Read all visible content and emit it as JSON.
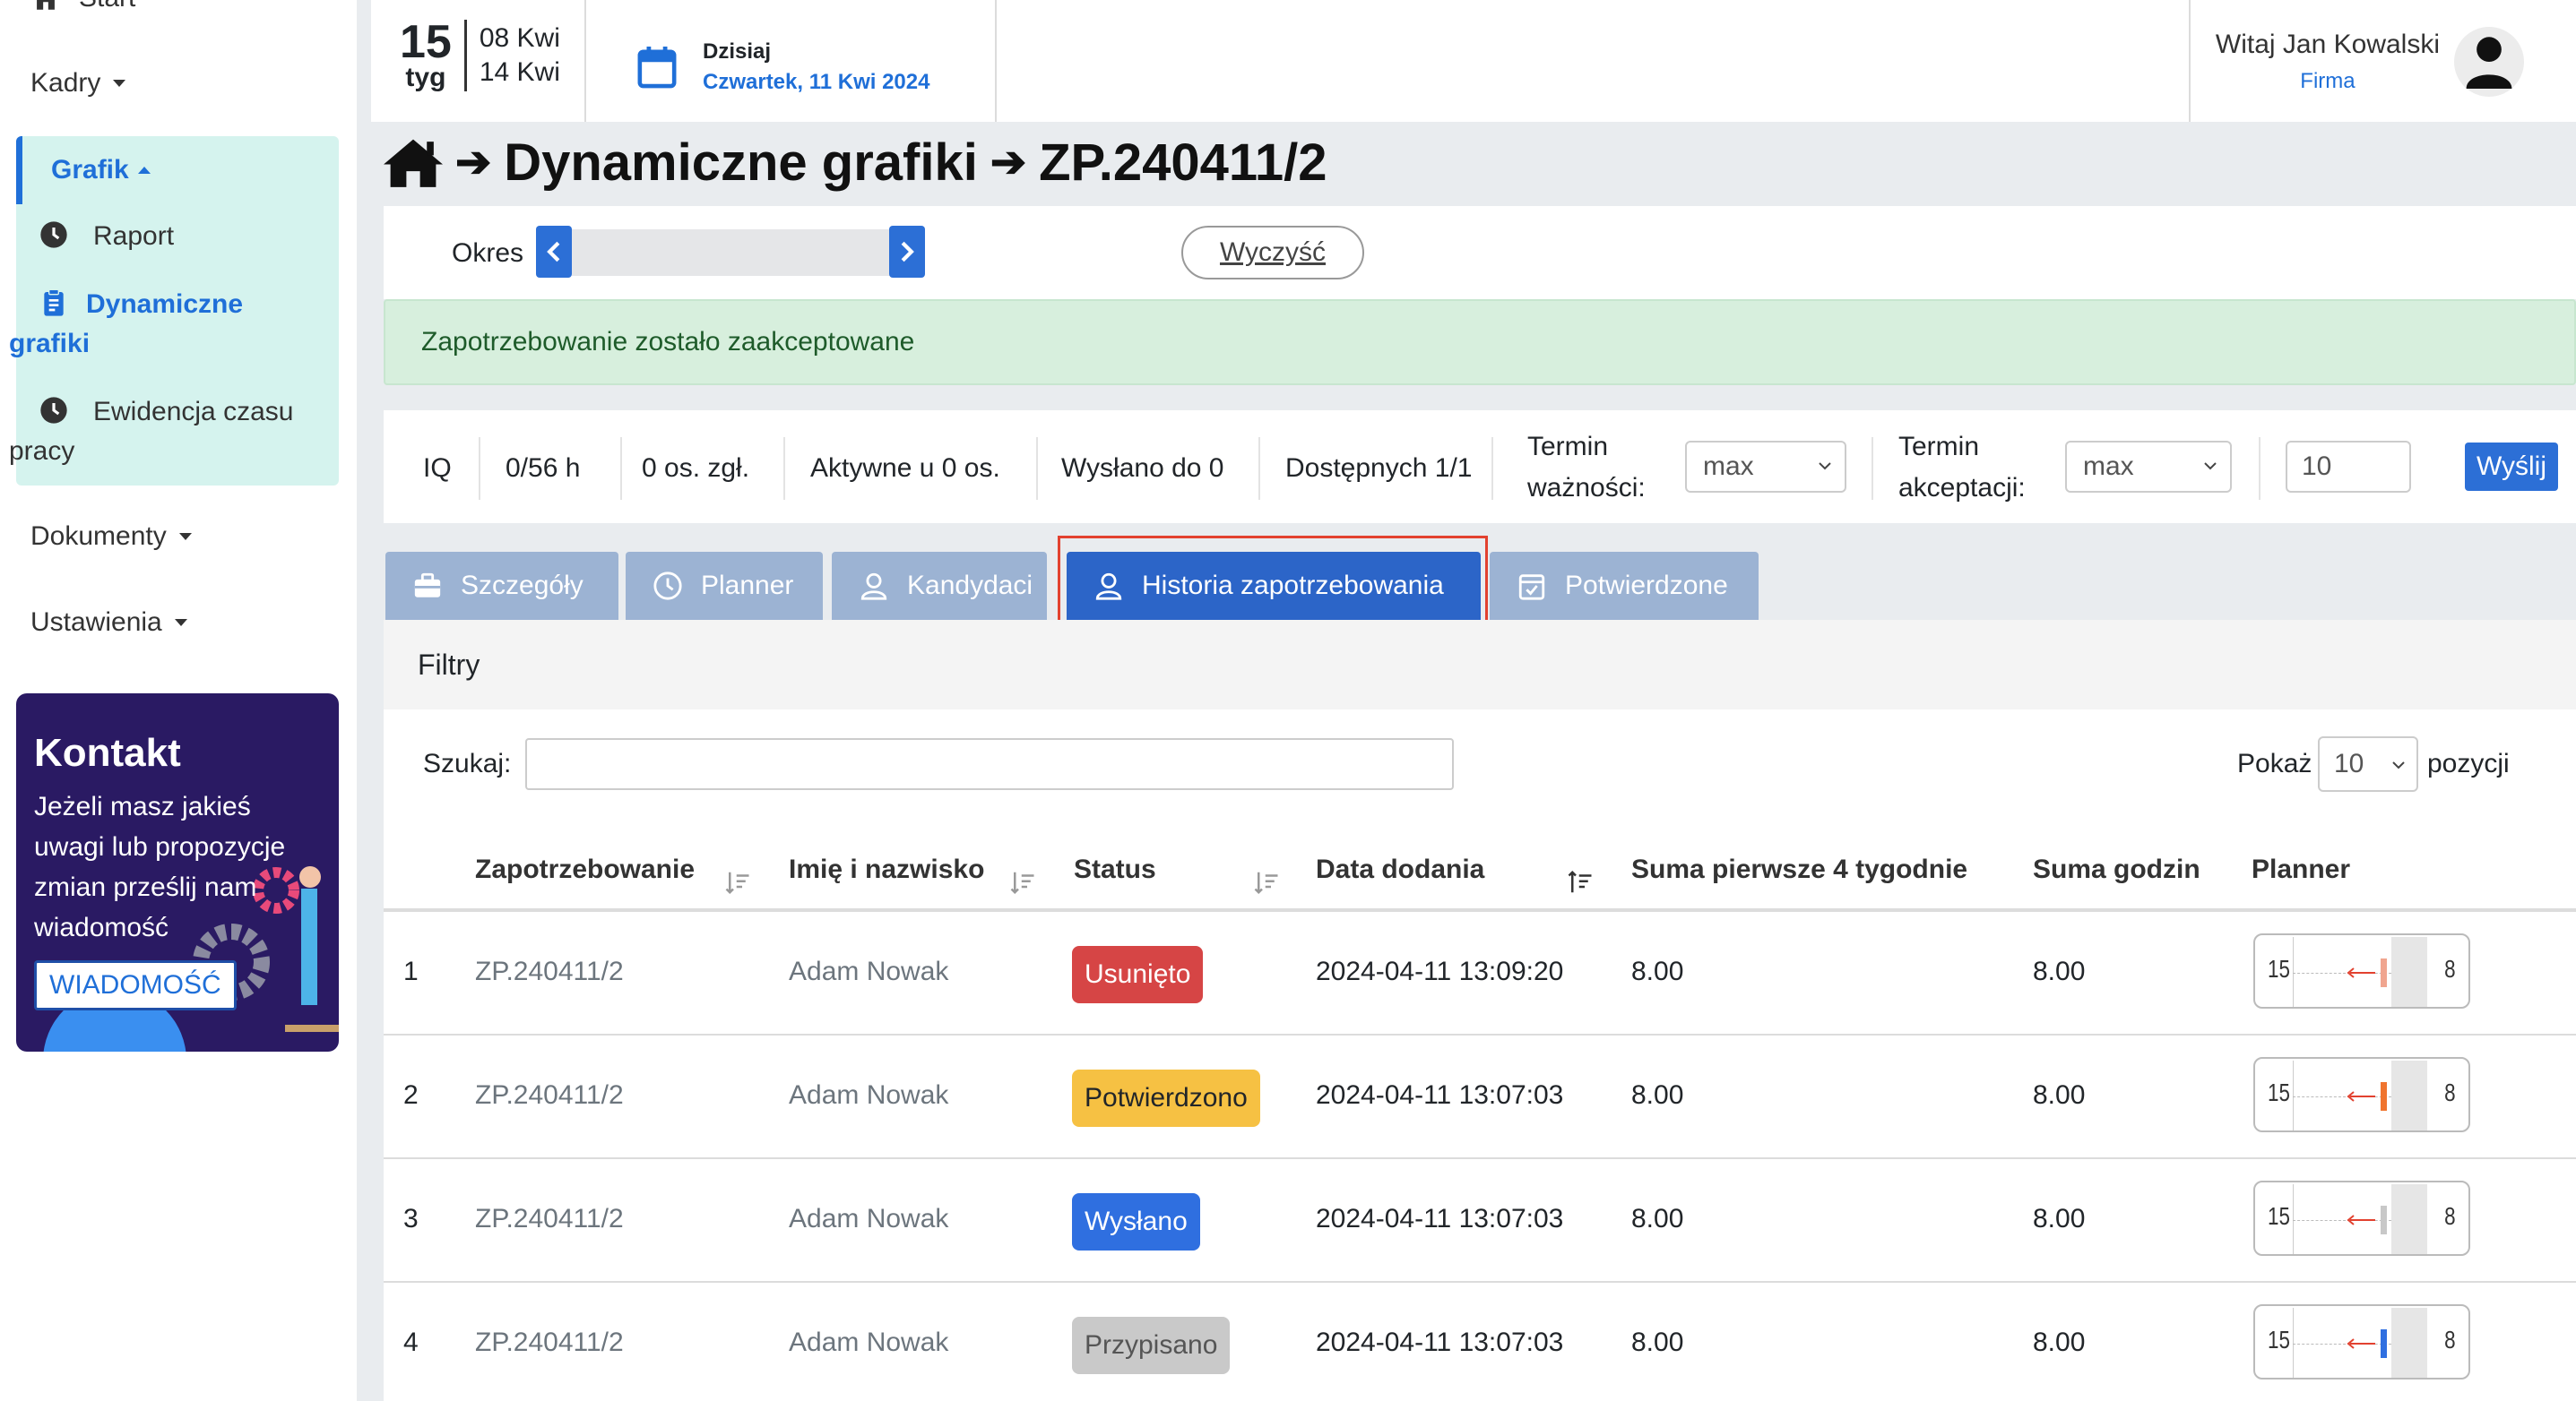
{
  "sidebar": {
    "start_label": "Start",
    "kadry_label": "Kadry",
    "grafik_label": "Grafik",
    "items": [
      {
        "label": "Raport"
      },
      {
        "label": "Dynamiczne grafiki"
      },
      {
        "label": "Ewidencja czasu pracy"
      }
    ],
    "dokumenty_label": "Dokumenty",
    "ustawienia_label": "Ustawienia",
    "kontakt": {
      "title": "Kontakt",
      "text": "Jeżeli masz jakieś uwagi lub propozycje zmian prześlij nam wiadomość",
      "button": "WIADOMOŚĆ"
    }
  },
  "topbar": {
    "week_number": "15",
    "week_label": "tyg",
    "date_from": "08 Kwi",
    "date_to": "14 Kwi",
    "today_label": "Dzisiaj",
    "today_date": "Czwartek, 11 Kwi 2024",
    "user_greeting": "Witaj Jan Kowalski",
    "user_company": "Firma"
  },
  "breadcrumb": {
    "section": "Dynamiczne grafiki",
    "current": "ZP.240411/2"
  },
  "period": {
    "label": "Okres",
    "clear_label": "Wyczyść"
  },
  "alert": {
    "text": "Zapotrzebowanie zostało zaakceptowane"
  },
  "stats": {
    "code": "IQ",
    "hours": "0/56 h",
    "reported": "0 os. zgł.",
    "active": "Aktywne u 0 os.",
    "sent": "Wysłano do 0",
    "available": "Dostępnych 1/1",
    "validity_label_1": "Termin",
    "validity_label_2": "ważności:",
    "validity_value": "max",
    "accept_label_1": "Termin",
    "accept_label_2": "akceptacji:",
    "accept_value": "max",
    "number_value": "10",
    "send_label": "Wyślij"
  },
  "tabs": [
    {
      "label": "Szczegóły",
      "active": false
    },
    {
      "label": "Planner",
      "active": false
    },
    {
      "label": "Kandydaci",
      "active": false
    },
    {
      "label": "Historia zapotrzebowania",
      "active": true
    },
    {
      "label": "Potwierdzone",
      "active": false
    }
  ],
  "filters": {
    "title": "Filtry",
    "search_label": "Szukaj:",
    "search_value": "",
    "show_label": "Pokaż",
    "show_value": "10",
    "show_suffix": "pozycji"
  },
  "table": {
    "columns": [
      "Zapotrzebowanie",
      "Imię i nazwisko",
      "Status",
      "Data dodania",
      "Suma pierwsze 4 tygodnie",
      "Suma godzin",
      "Planner"
    ],
    "rows": [
      {
        "no": "1",
        "request": "ZP.240411/2",
        "name": "Adam Nowak",
        "status": "Usunięto",
        "status_bg": "#d64545",
        "status_fg": "#ffffff",
        "date": "2024-04-11 13:09:20",
        "sum4": "8.00",
        "sum": "8.00",
        "planner_left": "15",
        "planner_right": "8",
        "marker_color": "#f0a58f"
      },
      {
        "no": "2",
        "request": "ZP.240411/2",
        "name": "Adam Nowak",
        "status": "Potwierdzono",
        "status_bg": "#f6c143",
        "status_fg": "#212529",
        "date": "2024-04-11 13:07:03",
        "sum4": "8.00",
        "sum": "8.00",
        "planner_left": "15",
        "planner_right": "8",
        "marker_color": "#f0742e"
      },
      {
        "no": "3",
        "request": "ZP.240411/2",
        "name": "Adam Nowak",
        "status": "Wysłano",
        "status_bg": "#2f6fe0",
        "status_fg": "#ffffff",
        "date": "2024-04-11 13:07:03",
        "sum4": "8.00",
        "sum": "8.00",
        "planner_left": "15",
        "planner_right": "8",
        "marker_color": "#c8c8c8"
      },
      {
        "no": "4",
        "request": "ZP.240411/2",
        "name": "Adam Nowak",
        "status": "Przypisano",
        "status_bg": "#c9c9c9",
        "status_fg": "#555555",
        "date": "2024-04-11 13:07:03",
        "sum4": "8.00",
        "sum": "8.00",
        "planner_left": "15",
        "planner_right": "8",
        "marker_color": "#2f6fe0"
      }
    ]
  }
}
